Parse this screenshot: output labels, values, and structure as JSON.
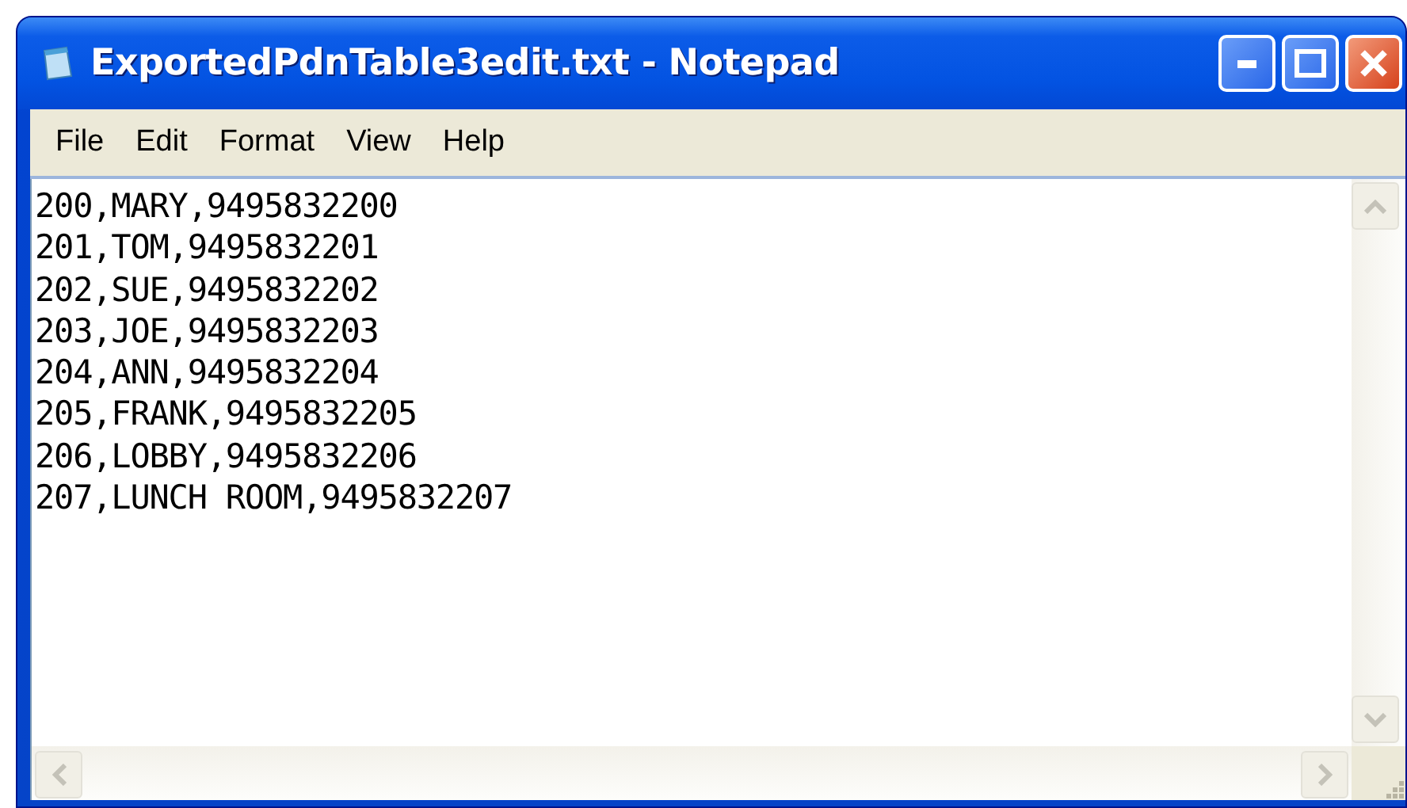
{
  "window": {
    "title": "ExportedPdnTable3edit.txt - Notepad"
  },
  "menu": [
    {
      "label": "File"
    },
    {
      "label": "Edit"
    },
    {
      "label": "Format"
    },
    {
      "label": "View"
    },
    {
      "label": "Help"
    }
  ],
  "document": {
    "lines": [
      "200,MARY,9495832200",
      "201,TOM,9495832201",
      "202,SUE,9495832202",
      "203,JOE,9495832203",
      "204,ANN,9495832204",
      "205,FRANK,9495832205",
      "206,LOBBY,9495832206",
      "207,LUNCH ROOM,9495832207"
    ]
  }
}
